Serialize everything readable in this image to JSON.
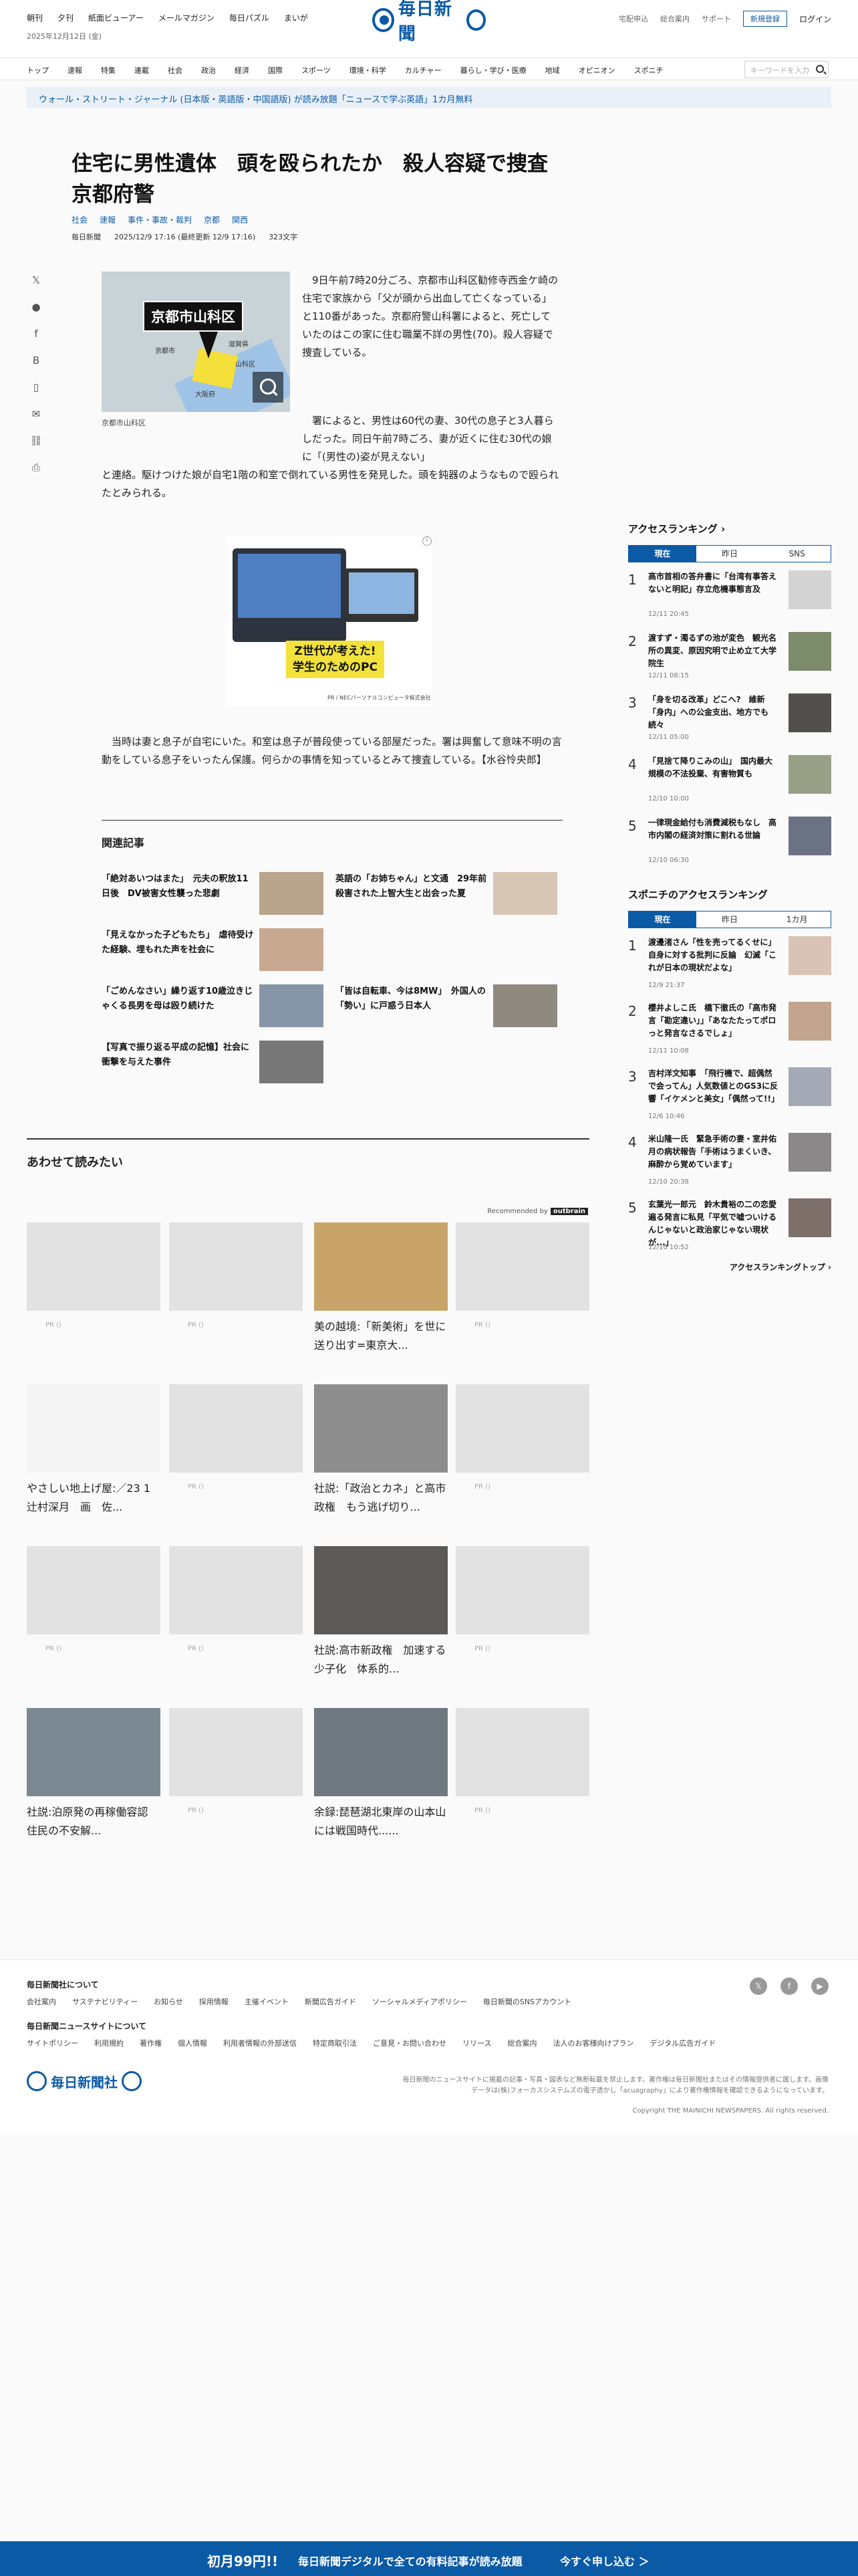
{
  "header": {
    "top_links": [
      "朝刊",
      "夕刊",
      "紙面ビューアー",
      "メールマガジン",
      "毎日パズル",
      "まいが"
    ],
    "date": "2025年12月12日 (金)",
    "logo_text": "毎日新聞",
    "right_links": [
      "宅配申込",
      "総合案内",
      "サポート"
    ],
    "register": "新規登録",
    "login": "ログイン"
  },
  "categories": [
    "トップ",
    "速報",
    "特集",
    "連載",
    "社会",
    "政治",
    "経済",
    "国際",
    "スポーツ",
    "環境・科学",
    "カルチャー",
    "暮らし・学び・医療",
    "地域",
    "オピニオン",
    "スポニチ"
  ],
  "search": {
    "placeholder": "キーワードを入力"
  },
  "promo": "ウォール・ストリート・ジャーナル (日本版・英語版・中国語版) が読み放題「ニュースで学ぶ英語」1カ月無料",
  "article": {
    "title": "住宅に男性遺体　頭を殴られたか　殺人容疑で捜査　京都府警",
    "tags": [
      "社会",
      "速報",
      "事件・事故・裁判",
      "京都",
      "関西"
    ],
    "source": "毎日新聞",
    "datetime": "2025/12/9 17:16 (最終更新 12/9 17:16)",
    "chars": "323文字",
    "photo_label": "京都市山科区",
    "map_places": [
      "京都市",
      "滋賀県",
      "山科区",
      "大阪府"
    ],
    "caption": "京都市山科区",
    "p1": "　9日午前7時20分ごろ、京都市山科区勧修寺西金ケ崎の住宅で家族から「父が頭から出血して亡くなっている」と110番があった。京都府警山科署によると、死亡していたのはこの家に住む職業不詳の男性(70)。殺人容疑で捜査している。",
    "p2a": "署によると、男性は60代の妻、30代の息子と3人暮らしだった。同日午前7時ごろ、妻が近くに住む30代の娘に「(男性の)姿が見えない」",
    "p2b": "と連絡。駆けつけた娘が自宅1階の和室で倒れている男性を発見した。頭を鈍器のようなもので殴られたとみられる。",
    "p3": "当時は妻と息子が自宅にいた。和室は息子が普段使っている部屋だった。署は興奮して意味不明の言動をしている息子をいったん保護。何らかの事情を知っているとみて捜査している。【水谷怜央郎】"
  },
  "ad": {
    "headline": "Z世代が考えた!\n学生のためのPC",
    "footer": "PR / NECパーソナルコンピュータ株式会社"
  },
  "related": {
    "heading": "関連記事",
    "items": [
      {
        "title": "「絶対あいつはまた」　元夫の釈放11日後　DV被害女性襲った悲劇"
      },
      {
        "title": "英語の「お姉ちゃん」と文通　29年前殺害された上智大生と出会った夏"
      },
      {
        "title": "「見えなかった子どもたち」　虐待受けた経験、埋もれた声を社会に"
      },
      {
        "title": "「ごめんなさい」繰り返す10歳泣きじゃくる長男を母は殴り続けた"
      },
      {
        "title": "「皆は自転車、今は8MW」　外国人の「勢い」に戸惑う日本人"
      },
      {
        "title": "【写真で振り返る平成の記憶】社会に衝撃を与えた事件"
      }
    ]
  },
  "together": {
    "heading": "あわせて読みたい",
    "recommended": "Recommended by",
    "recommended_brand": "outbrain",
    "pr_label": "PR ()",
    "items": [
      "美の越境:「新美術」を世に送り出す=東京大...",
      "やさしい地上げ屋:／23 1　辻村深月　画　佐...",
      "社説:「政治とカネ」と高市政権　もう逃げ切り...",
      "社説:高市新政権　加速する少子化　体系的...",
      "社説:泊原発の再稼働容認　住民の不安解...",
      "余録:琵琶湖北東岸の山本山には戦国時代......"
    ]
  },
  "sidebar": {
    "ranking_title": "アクセスランキング",
    "tabs": [
      "現在",
      "昨日",
      "SNS"
    ],
    "ranks": [
      {
        "title": "高市首相の答弁書に「台湾有事答えないと明記」存立危機事態言及",
        "date": "12/11 20:45"
      },
      {
        "title": "渡すず・濁るずの池が変色　観光名所の異変、原因究明で止め立て大学院生",
        "date": "12/11 08:15"
      },
      {
        "title": "「身を切る改革」どこへ?　維新「身内」への公金支出、地方でも続々",
        "date": "12/11 05:00"
      },
      {
        "title": "「見捨て降りこみの山」　国内最大規模の不法投棄、有害物質も",
        "date": "12/10 10:00"
      },
      {
        "title": "一律現金給付も消費減税もなし　高市内閣の経済対策に割れる世論",
        "date": "12/10 06:30"
      }
    ],
    "sponichi_title": "スポニチのアクセスランキング",
    "sponichi_tabs": [
      "現在",
      "昨日",
      "1カ月"
    ],
    "sponichi": [
      {
        "title": "渡邊渚さん「性を売ってるくせに」自身に対する批判に反論　幻滅「これが日本の現状だよな」",
        "date": "12/9 21:37"
      },
      {
        "title": "櫻井よしこ氏　橋下徹氏の「高市発言「勘定違い」」「あなたたってポロっと発言なさるでしょ」",
        "date": "12/11 10:08"
      },
      {
        "title": "吉村洋文知事　「飛行機で、超偶然で会ってん」人気数値とのGS3に反響「イケメンと美女」「偶然って!!」",
        "date": "12/6 10:46"
      },
      {
        "title": "米山隆一氏　緊急手術の妻・室井佑月の病状報告「手術はうまくいき、麻酔から覚めています」",
        "date": "12/10 20:38"
      },
      {
        "title": "玄葉光一郎元　鈴木貴裕の二の恋愛遍る発言に私見「平気で嘘ついけるんじゃないと政治家じゃない現状が...」",
        "date": "12/10 10:52"
      }
    ],
    "more": "アクセスランキングトップ"
  },
  "footer": {
    "about_title": "毎日新聞社について",
    "about_links": [
      "会社案内",
      "サステナビリティー",
      "お知らせ",
      "採用情報",
      "主催イベント",
      "新聞広告ガイド",
      "ソーシャルメディアポリシー",
      "毎日新聞のSNSアカウント"
    ],
    "site_title": "毎日新聞ニュースサイトについて",
    "site_links": [
      "サイトポリシー",
      "利用規約",
      "著作権",
      "個人情報",
      "利用者情報の外部送信",
      "特定商取引法",
      "ご意見・お問い合わせ",
      "リリース",
      "総合案内",
      "法人のお客様向けプラン",
      "デジタル広告ガイド"
    ],
    "logo_text": "毎日新聞社",
    "note": "毎日新聞のニュースサイトに掲載の記事・写真・図表など無断転載を禁止します。著作権は毎日新聞社またはその情報提供者に属します。画像データは(株)フォーカスシステムズの電子透かし「acuagraphy」により著作権情報を確認できるようになっています。",
    "copyright": "Copyright THE MAINICHI NEWSPAPERS. All rights reserved."
  },
  "bottom_bar": {
    "price": "初月99円!!",
    "message": "毎日新聞デジタルで全ての有料記事が読み放題",
    "cta": "今すぐ申し込む ＞"
  }
}
